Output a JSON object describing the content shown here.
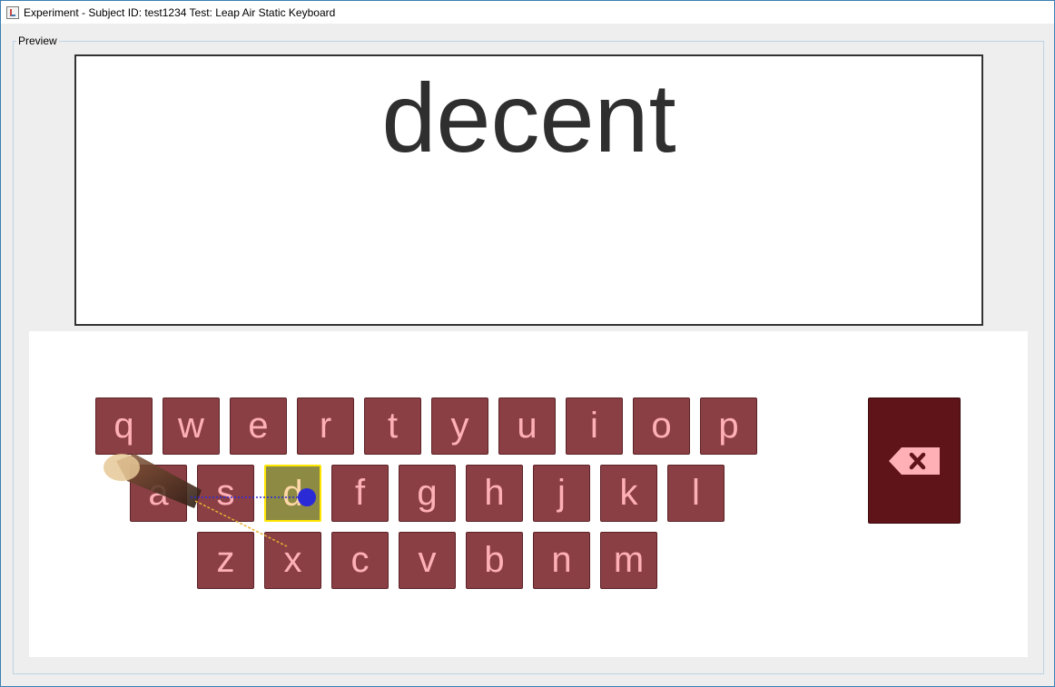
{
  "window": {
    "title": "Experiment - Subject ID: test1234 Test: Leap Air Static Keyboard"
  },
  "preview": {
    "legend": "Preview"
  },
  "target_word": "decent",
  "typed_text": "",
  "keyboard": {
    "rows": [
      [
        "q",
        "w",
        "e",
        "r",
        "t",
        "y",
        "u",
        "i",
        "o",
        "p"
      ],
      [
        "a",
        "s",
        "d",
        "f",
        "g",
        "h",
        "j",
        "k",
        "l"
      ],
      [
        "z",
        "x",
        "c",
        "v",
        "b",
        "n",
        "m"
      ]
    ],
    "active_key": "d",
    "backspace_icon": "backspace-icon"
  },
  "colors": {
    "key_bg": "#8a3f45",
    "key_text": "#ffb0b6",
    "active_key_bg": "#8c8a43",
    "active_key_border": "#ffe600",
    "backspace_bg": "#5e1418",
    "cursor": "#2a2ad6"
  }
}
